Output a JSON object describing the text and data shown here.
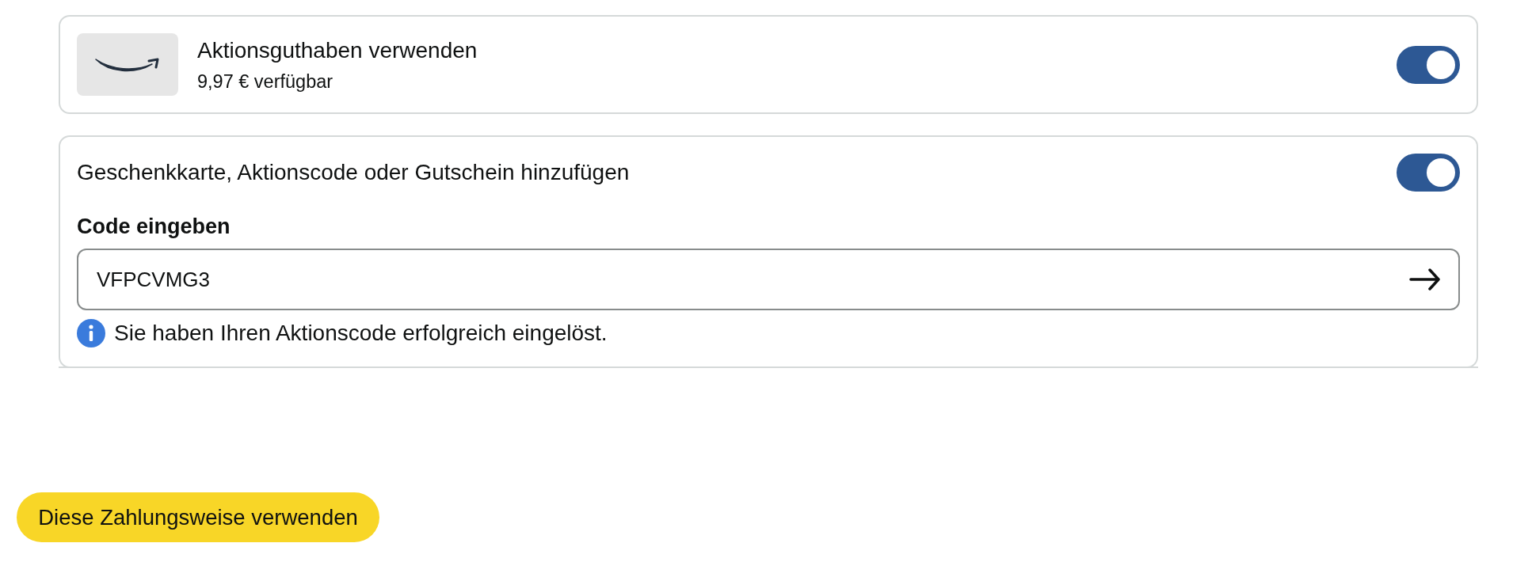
{
  "promo_balance": {
    "title": "Aktionsguthaben verwenden",
    "available": "9,97 € verfügbar",
    "on": true
  },
  "gift_card": {
    "title": "Geschenkkarte, Aktionscode oder Gutschein hinzufügen",
    "on": true,
    "code_label": "Code eingeben",
    "code_field": {
      "value": "VFPCVMG3"
    },
    "message": "Sie haben Ihren Aktionscode erfolgreich eingelöst."
  },
  "submit_button": {
    "label": "Diese Zahlungsweise verwenden"
  }
}
